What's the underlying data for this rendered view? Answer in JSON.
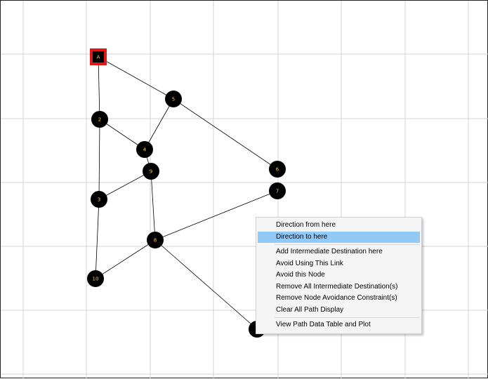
{
  "graph": {
    "nodes": [
      {
        "id": "A",
        "label": "A",
        "selected": true
      },
      {
        "id": "2",
        "label": "2"
      },
      {
        "id": "3",
        "label": "3"
      },
      {
        "id": "4",
        "label": "4"
      },
      {
        "id": "5",
        "label": "5"
      },
      {
        "id": "6",
        "label": "6"
      },
      {
        "id": "7",
        "label": "7"
      },
      {
        "id": "8",
        "label": "8"
      },
      {
        "id": "9",
        "label": "9"
      },
      {
        "id": "10",
        "label": "10"
      },
      {
        "id": "11",
        "label": "6"
      }
    ],
    "edges": [
      [
        "A",
        "2"
      ],
      [
        "A",
        "5"
      ],
      [
        "2",
        "4"
      ],
      [
        "2",
        "3"
      ],
      [
        "5",
        "4"
      ],
      [
        "5",
        "6"
      ],
      [
        "4",
        "9"
      ],
      [
        "9",
        "3"
      ],
      [
        "9",
        "8"
      ],
      [
        "3",
        "10"
      ],
      [
        "10",
        "8"
      ],
      [
        "8",
        "7"
      ],
      [
        "8",
        "11"
      ]
    ],
    "colors": {
      "node_fill": "#000000",
      "node_label": "#f2d24a",
      "selected_fill": "#e01818",
      "edge": "#000000",
      "grid": "#d3d3d3"
    }
  },
  "context_menu": {
    "items": [
      {
        "label": "Direction from here",
        "highlighted": false
      },
      {
        "label": "Direction to here",
        "highlighted": true
      },
      {
        "separator": true
      },
      {
        "label": "Add Intermediate Destination here",
        "highlighted": false
      },
      {
        "label": "Avoid Using This Link",
        "highlighted": false
      },
      {
        "label": "Avoid this Node",
        "highlighted": false
      },
      {
        "label": "Remove All Intermediate Destination(s)",
        "highlighted": false
      },
      {
        "label": "Remove Node Avoidance Constraint(s)",
        "highlighted": false
      },
      {
        "label": "Clear All Path Display",
        "highlighted": false
      },
      {
        "separator": true
      },
      {
        "label": "View Path Data Table and Plot",
        "highlighted": false
      }
    ]
  }
}
